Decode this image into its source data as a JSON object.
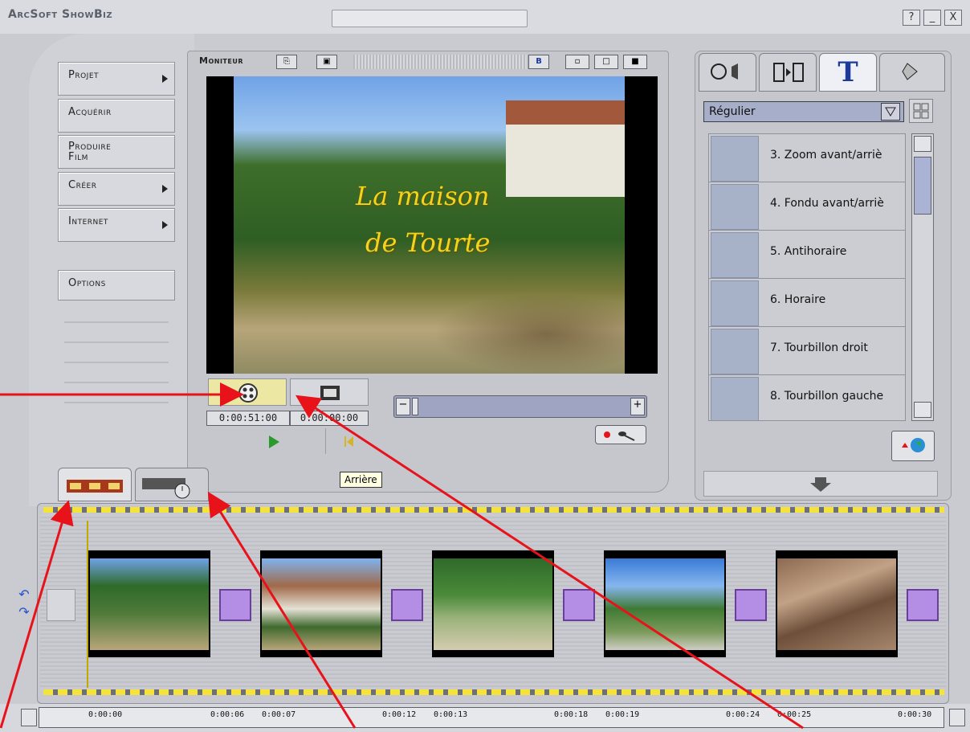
{
  "app": {
    "title": "ArcSoft ShowBiz"
  },
  "window_buttons": [
    "?",
    "_",
    "X"
  ],
  "nav": {
    "projet": "Projet",
    "acquerir": "Acquérir",
    "produire": [
      "Produire",
      "Film"
    ],
    "creer": "Créer",
    "internet": "Internet",
    "options": "Options"
  },
  "monitor": {
    "label": "Moniteur",
    "caption_line1": "La maison",
    "caption_line2": "de Tourte",
    "timecode_current": "0:00:51:00",
    "timecode_other": "0:00:00:00",
    "tooltip": "Arrière"
  },
  "text_panel": {
    "style_dropdown": "Régulier",
    "effects": [
      {
        "label": "3. Zoom avant/arriè"
      },
      {
        "label": "4. Fondu avant/arriè"
      },
      {
        "label": "5. Antihoraire"
      },
      {
        "label": "6. Horaire"
      },
      {
        "label": "7. Tourbillon droit"
      },
      {
        "label": "8. Tourbillon gauche"
      }
    ]
  },
  "ruler": {
    "ticks": [
      "0:00:00",
      "0:00:06",
      "0:00:07",
      "0:00:12",
      "0:00:13",
      "0:00:18",
      "0:00:19",
      "0:00:24",
      "0:00:25",
      "0:00:30"
    ]
  },
  "colors": {
    "annotation_arrow": "#e8121b",
    "caption_text": "#f3d31c",
    "transition": "#b48ee4"
  }
}
